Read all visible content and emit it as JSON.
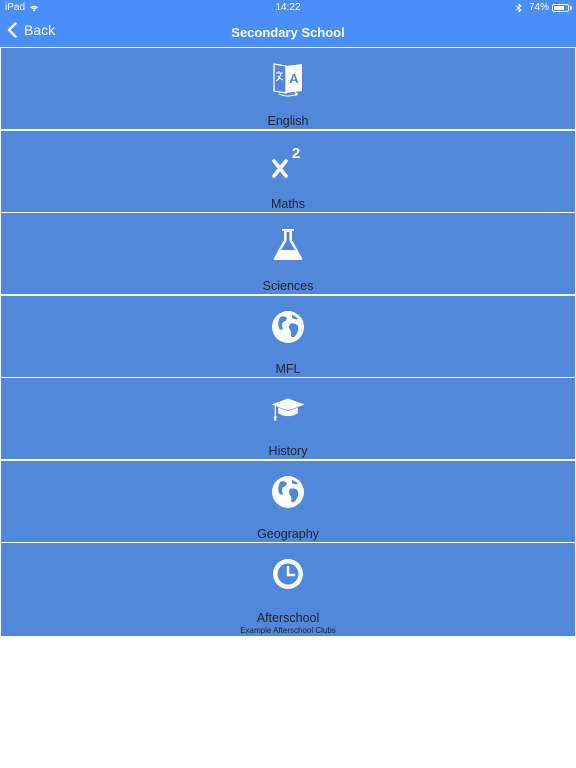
{
  "status": {
    "device": "iPad",
    "time": "14:22",
    "battery": "74%",
    "battery_level": 0.74,
    "icons": [
      "wifi-icon",
      "bluetooth-icon",
      "battery-icon"
    ]
  },
  "nav": {
    "back_label": "Back",
    "title": "Secondary School"
  },
  "colors": {
    "bar": "#4a8ff7",
    "tile": "#5288d9",
    "label": "#1b2332"
  },
  "menu": {
    "items": [
      {
        "label": "English",
        "icon": "translate-icon"
      },
      {
        "label": "Maths",
        "icon": "x-squared-icon"
      },
      {
        "label": "Sciences",
        "icon": "flask-icon"
      },
      {
        "label": "MFL",
        "icon": "globe-icon"
      },
      {
        "label": "History",
        "icon": "graduation-cap-icon"
      },
      {
        "label": "Geography",
        "icon": "globe-icon"
      },
      {
        "label": "Afterschool",
        "subtitle": "Example Afterschool Clubs",
        "icon": "clock-icon"
      }
    ]
  }
}
